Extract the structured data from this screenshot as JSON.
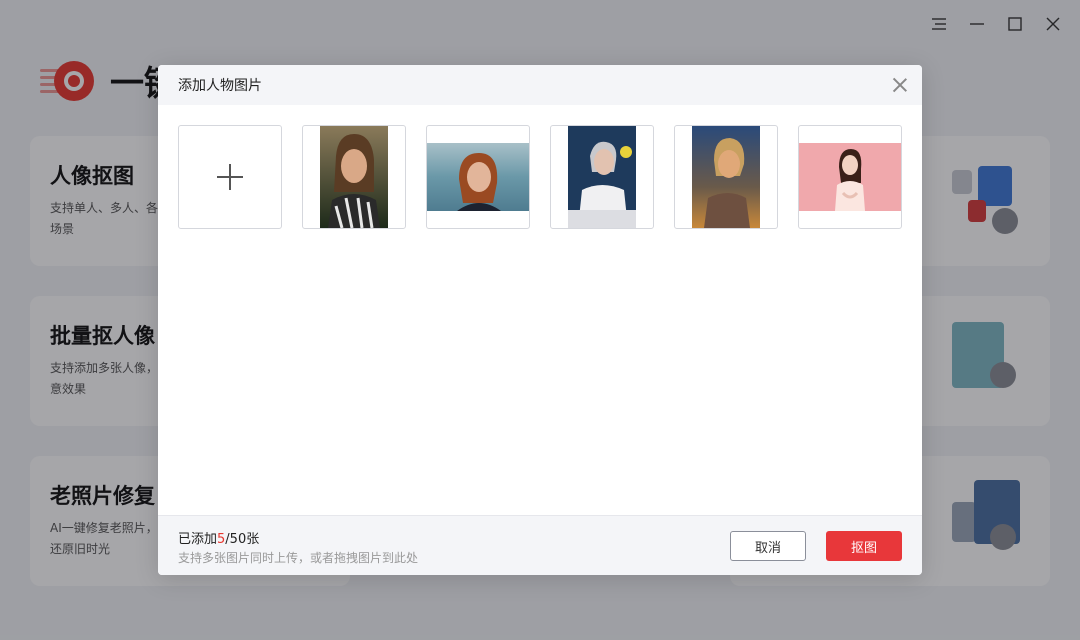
{
  "app": {
    "name": "一键抠图",
    "window_controls": [
      "menu-icon",
      "minimize-icon",
      "maximize-icon",
      "close-icon"
    ],
    "cards": [
      {
        "title": "人像抠图",
        "desc": "支持单人、多人、各场景"
      },
      {
        "title": "批量抠人像",
        "desc": "支持添加多张人像，意效果"
      },
      {
        "title": "老照片修复",
        "desc": "AI一键修复老照片，还原旧时光"
      }
    ],
    "brand_color": "#e8372f"
  },
  "dialog": {
    "title": "添加人物图片",
    "add_tile_icon": "plus-icon",
    "images": [
      {
        "name": "woman-striped-shirt"
      },
      {
        "name": "woman-red-hair-lake"
      },
      {
        "name": "woman-silver-hair-dark-bg"
      },
      {
        "name": "woman-sunset"
      },
      {
        "name": "woman-pink-bg"
      }
    ],
    "count_prefix": "已添加",
    "count_current": "5",
    "count_suffix": "/50张",
    "hint": "支持多张图片同时上传，或者拖拽图片到此处",
    "cancel_label": "取消",
    "confirm_label": "抠图"
  }
}
